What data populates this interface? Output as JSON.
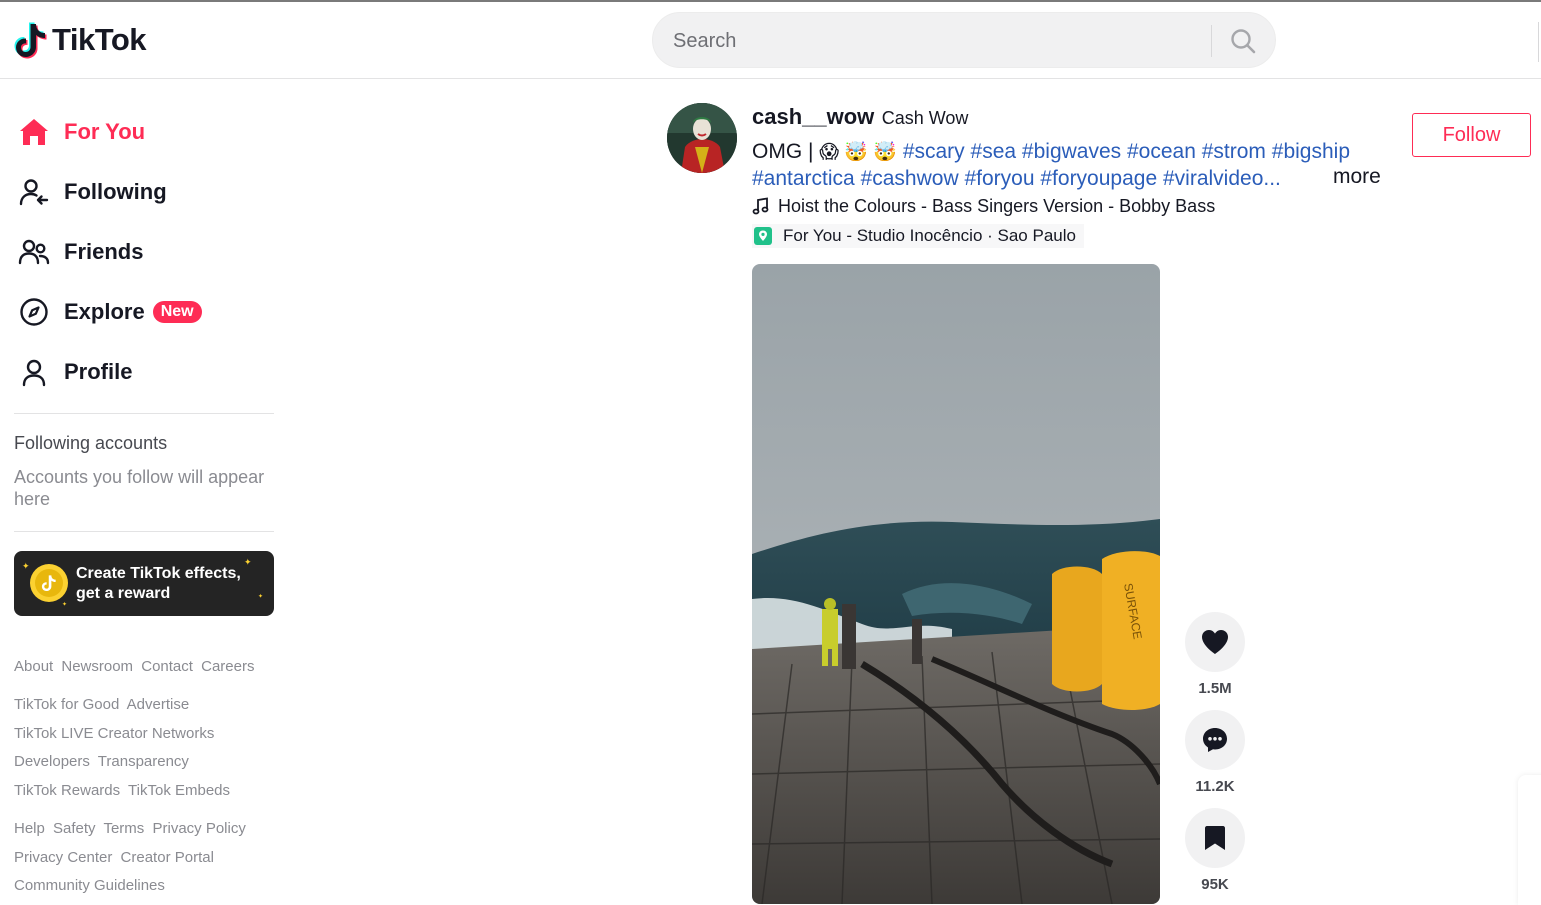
{
  "app": {
    "logo_text": "TikTok"
  },
  "search": {
    "placeholder": "Search"
  },
  "sidebar": {
    "items": [
      {
        "label": "For You",
        "icon": "home-icon",
        "active": true
      },
      {
        "label": "Following",
        "icon": "following-icon"
      },
      {
        "label": "Friends",
        "icon": "friends-icon"
      },
      {
        "label": "Explore",
        "icon": "compass-icon",
        "badge": "New"
      },
      {
        "label": "Profile",
        "icon": "profile-icon"
      }
    ],
    "following_accounts_title": "Following accounts",
    "following_accounts_desc": "Accounts you follow will appear here",
    "promo_text": "Create TikTok effects, get a reward",
    "footer_links": [
      [
        "About",
        "Newsroom",
        "Contact",
        "Careers"
      ],
      [
        "TikTok for Good",
        "Advertise"
      ],
      [
        "TikTok LIVE Creator Networks"
      ],
      [
        "Developers",
        "Transparency"
      ],
      [
        "TikTok Rewards",
        "TikTok Embeds"
      ],
      [
        "Help",
        "Safety",
        "Terms",
        "Privacy Policy"
      ],
      [
        "Privacy Center",
        "Creator Portal"
      ],
      [
        "Community Guidelines"
      ]
    ]
  },
  "post": {
    "username": "cash__wow",
    "nickname": "Cash Wow",
    "follow_label": "Follow",
    "caption_prefix": "OMG | ",
    "caption_emojis": "😱 🤯 🤯",
    "hashtags_line1": [
      "#scary",
      "#sea",
      "#bigwaves",
      "#ocean",
      "#strom",
      "#bigship"
    ],
    "hashtags_line2": [
      "#antarctica",
      "#cashwow",
      "#foryou",
      "#foryoupage",
      "#viralvideo..."
    ],
    "more_label": "more",
    "music": "Hoist the Colours - Bass Singers Version - Bobby Bass",
    "location": "For You - Studio Inocêncio · Sao Paulo",
    "actions": {
      "likes": "1.5M",
      "comments": "11.2K",
      "saves": "95K"
    }
  },
  "colors": {
    "brand": "#fe2c55",
    "hashtag": "#2b5db9",
    "text": "#161823"
  }
}
